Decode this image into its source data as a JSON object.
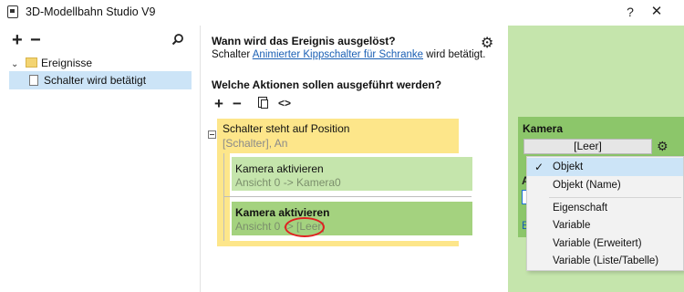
{
  "window": {
    "title": "3D-Modellbahn Studio V9",
    "help_label": "?",
    "close_label": "✕"
  },
  "left": {
    "add_label": "+",
    "remove_label": "−",
    "tree": [
      {
        "label": "Ereignisse",
        "icon": "folder-icon",
        "expanded": true
      },
      {
        "label": "Schalter wird betätigt",
        "icon": "document-icon",
        "selected": true
      }
    ]
  },
  "event": {
    "question": "Wann wird das Ereignis ausgelöst?",
    "trigger_prefix": "Schalter",
    "trigger_link": "Animierter Kippschalter für Schranke",
    "trigger_suffix": "wird betätigt."
  },
  "actions": {
    "question": "Welche Aktionen sollen ausgeführt werden?",
    "toolbar": {
      "add": "+",
      "remove": "−",
      "code": "<>"
    },
    "condition": {
      "title": "Schalter steht auf Position",
      "subtitle": "[Schalter], An"
    },
    "items": [
      {
        "title": "Kamera aktivieren",
        "subtitle": "Ansicht 0 -> Kamera0"
      },
      {
        "title": "Kamera aktivieren",
        "subtitle": "Ansicht 0 -> [Leer]"
      }
    ]
  },
  "properties": {
    "label": "Kamera",
    "value": "[Leer]",
    "fragments": [
      "A",
      "E"
    ]
  },
  "dropdown": {
    "items": [
      {
        "label": "Objekt",
        "checked": true
      },
      {
        "label": "Objekt (Name)",
        "checked": false
      },
      {
        "label": "Eigenschaft",
        "checked": false
      },
      {
        "label": "Variable",
        "checked": false
      },
      {
        "label": "Variable (Erweitert)",
        "checked": false
      },
      {
        "label": "Variable (Liste/Tabelle)",
        "checked": false
      }
    ]
  },
  "colors": {
    "condition_bg": "#fde68a",
    "action_bg": "#c5e5ac",
    "action_selected_bg": "#a4d27f",
    "panel_bg": "#c5e5ac",
    "link": "#1a5fb4",
    "highlight_circle": "#e02020"
  }
}
